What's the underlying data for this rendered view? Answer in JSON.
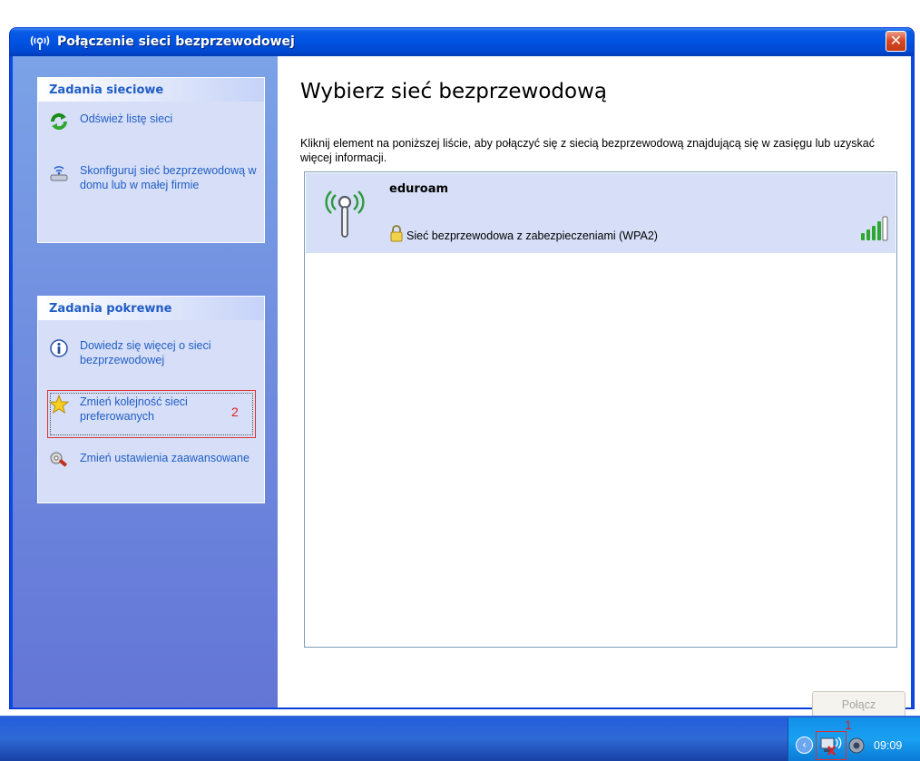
{
  "window": {
    "title": "Połączenie sieci bezprzewodowej",
    "close_label": "✕"
  },
  "tasks": {
    "network_tasks": {
      "header": "Zadania sieciowe",
      "items": [
        {
          "label": "Odśwież listę sieci",
          "icon": "refresh-icon"
        },
        {
          "label": "Skonfiguruj sieć bezprzewodową w domu lub w małej firmie",
          "icon": "setup-wizard-icon"
        }
      ]
    },
    "related_tasks": {
      "header": "Zadania pokrewne",
      "items": [
        {
          "label": "Dowiedz się więcej o sieci bezprzewodowej",
          "icon": "info-icon"
        },
        {
          "label": "Zmień kolejność sieci preferowanych",
          "icon": "star-icon"
        },
        {
          "label": "Zmień ustawienia zaawansowane",
          "icon": "settings-icon"
        }
      ]
    }
  },
  "annotations": {
    "marker_1": "1",
    "marker_2": "2"
  },
  "main": {
    "title": "Wybierz sieć bezprzewodową",
    "description": "Kliknij element na poniższej liście, aby połączyć się z siecią bezprzewodową znajdującą się w zasięgu lub uzyskać więcej informacji.",
    "networks": [
      {
        "ssid": "eduroam",
        "security": "Sieć bezprzewodowa z zabezpieczeniami (WPA2)",
        "signal_bars": 5
      }
    ],
    "connect_button": "Połącz"
  },
  "taskbar": {
    "clock": "09:09",
    "chevron": "‹"
  },
  "colors": {
    "titlebar": "#0053e1",
    "task_link": "#215dc6",
    "annotation": "#e02020"
  }
}
